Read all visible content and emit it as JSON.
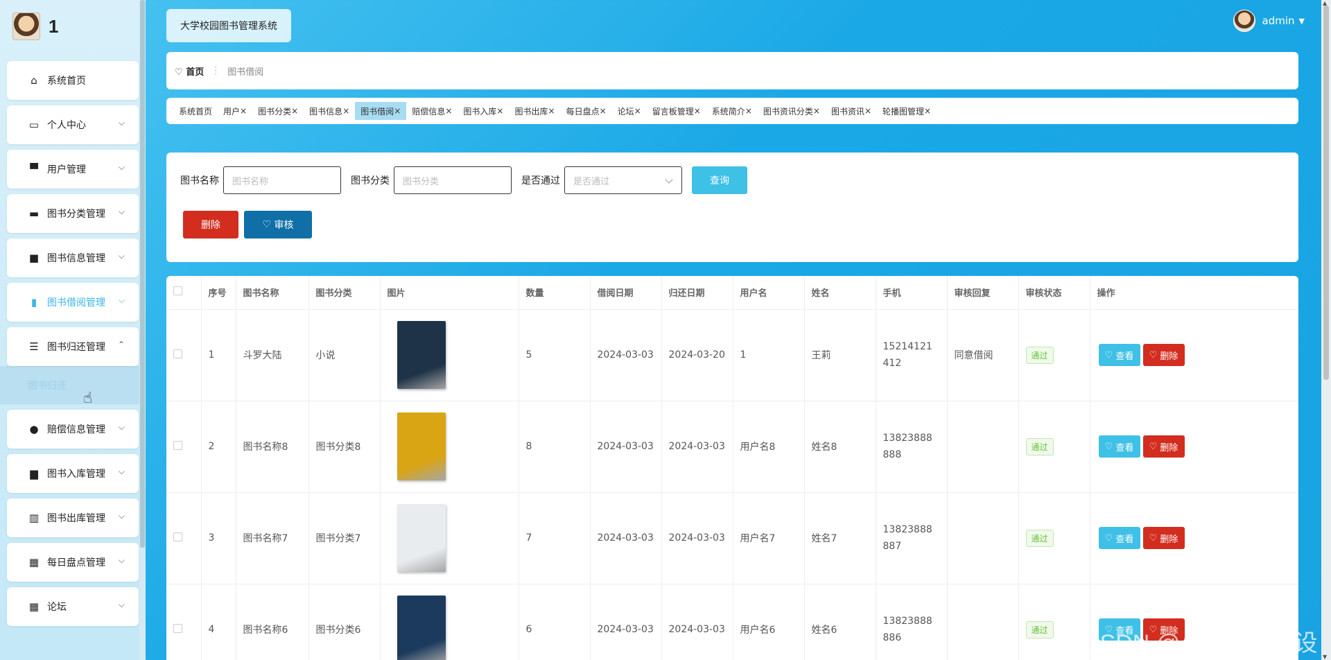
{
  "brand": {
    "name": "1"
  },
  "sidebar": {
    "items": [
      {
        "label": "系统首页",
        "icon": "home-icon"
      },
      {
        "label": "个人中心",
        "icon": "calendar-icon"
      },
      {
        "label": "用户管理",
        "icon": "paint-roller-icon"
      },
      {
        "label": "图书分类管理",
        "icon": "chat-bubble-icon"
      },
      {
        "label": "图书信息管理",
        "icon": "briefcase-icon"
      },
      {
        "label": "图书借阅管理",
        "icon": "clipboard-icon"
      },
      {
        "label": "图书归还管理",
        "icon": "sliders-icon"
      },
      {
        "label": "赔偿信息管理",
        "icon": "user-icon"
      },
      {
        "label": "图书入库管理",
        "icon": "monitor-icon"
      },
      {
        "label": "图书出库管理",
        "icon": "books-icon"
      },
      {
        "label": "每日盘点管理",
        "icon": "grid-icon"
      },
      {
        "label": "论坛",
        "icon": "grid-icon"
      }
    ],
    "submenu_label": "图书归还"
  },
  "header": {
    "title": "大学校园图书管理系统",
    "user": "admin"
  },
  "breadcrumb": {
    "home": "首页",
    "current": "图书借阅"
  },
  "tabs": [
    "系统首页",
    "用户",
    "图书分类",
    "图书信息",
    "图书借阅",
    "赔偿信息",
    "图书入库",
    "图书出库",
    "每日盘点",
    "论坛",
    "留言板管理",
    "系统简介",
    "图书资讯分类",
    "图书资讯",
    "轮播图管理"
  ],
  "active_tab": "图书借阅",
  "search": {
    "name_label": "图书名称",
    "name_placeholder": "图书名称",
    "category_label": "图书分类",
    "category_placeholder": "图书分类",
    "passed_label": "是否通过",
    "passed_placeholder": "是否通过",
    "query_button": "查询",
    "delete_button": "删除",
    "audit_button": "审核"
  },
  "table": {
    "headers": [
      "序号",
      "图书名称",
      "图书分类",
      "图片",
      "数量",
      "借阅日期",
      "归还日期",
      "用户名",
      "姓名",
      "手机",
      "审核回复",
      "审核状态",
      "操作"
    ],
    "rows": [
      {
        "no": "1",
        "name": "斗罗大陆",
        "category": "小说",
        "qty": "5",
        "borrow": "2024-03-03",
        "return": "2024-03-20",
        "username": "1",
        "realname": "王莉",
        "phone": "15214121412",
        "reply": "同意借阅",
        "status": "通过",
        "cover": "#1e3347"
      },
      {
        "no": "2",
        "name": "图书名称8",
        "category": "图书分类8",
        "qty": "8",
        "borrow": "2024-03-03",
        "return": "2024-03-03",
        "username": "用户名8",
        "realname": "姓名8",
        "phone": "13823888888",
        "reply": "",
        "status": "通过",
        "cover": "#d9a514"
      },
      {
        "no": "3",
        "name": "图书名称7",
        "category": "图书分类7",
        "qty": "7",
        "borrow": "2024-03-03",
        "return": "2024-03-03",
        "username": "用户名7",
        "realname": "姓名7",
        "phone": "13823888887",
        "reply": "",
        "status": "通过",
        "cover": "#e8ecef"
      },
      {
        "no": "4",
        "name": "图书名称6",
        "category": "图书分类6",
        "qty": "6",
        "borrow": "2024-03-03",
        "return": "2024-03-03",
        "username": "用户名6",
        "realname": "姓名6",
        "phone": "13823888886",
        "reply": "",
        "status": "通过",
        "cover": "#1b3a5e"
      }
    ],
    "view_label": "查看",
    "del_label": "删除"
  },
  "watermark": "CSDN @小五java毕设"
}
